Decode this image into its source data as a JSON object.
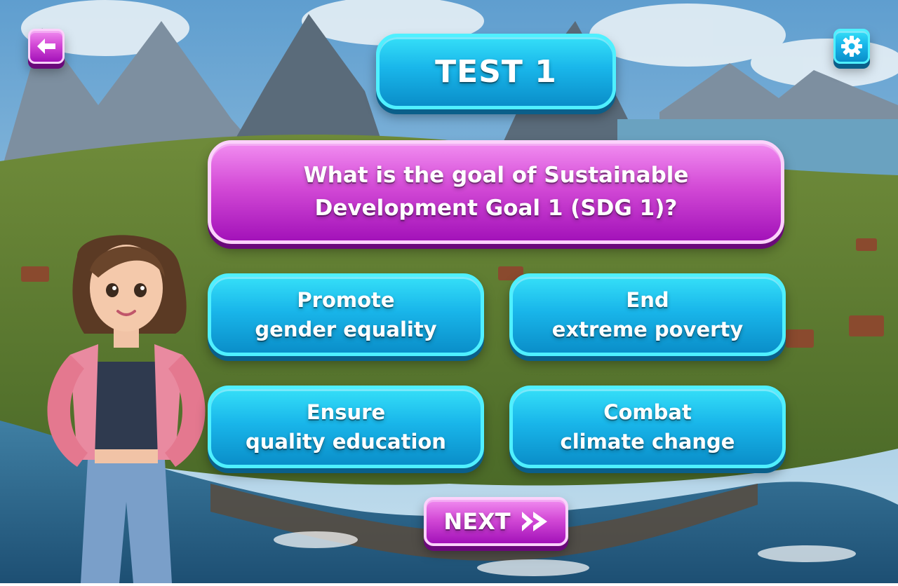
{
  "header": {
    "title": "TEST 1",
    "back_icon": "arrow-left-icon",
    "settings_icon": "gear-icon"
  },
  "question": {
    "line1": "What is the goal of Sustainable",
    "line2": "Development Goal 1 (SDG 1)?"
  },
  "answers": [
    {
      "line1": "Promote",
      "line2": "gender equality"
    },
    {
      "line1": "End",
      "line2": "extreme poverty"
    },
    {
      "line1": "Ensure",
      "line2": "quality education"
    },
    {
      "line1": "Combat",
      "line2": "climate change"
    }
  ],
  "footer": {
    "next_label": "NEXT",
    "next_icon": "double-chevron-right-icon"
  },
  "colors": {
    "cyan_button": "#19b6ea",
    "magenta_button": "#d34ad6",
    "sky": "#8fc3e3",
    "sea": "#2f6f93"
  }
}
